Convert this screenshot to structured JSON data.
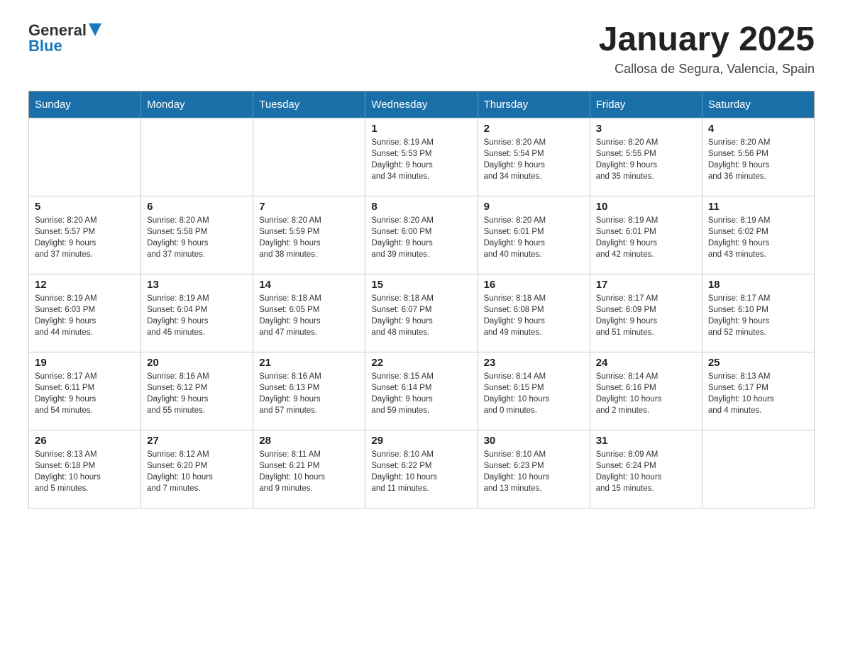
{
  "header": {
    "logo": {
      "text_general": "General",
      "text_blue": "Blue"
    },
    "title": "January 2025",
    "location": "Callosa de Segura, Valencia, Spain"
  },
  "days_of_week": [
    "Sunday",
    "Monday",
    "Tuesday",
    "Wednesday",
    "Thursday",
    "Friday",
    "Saturday"
  ],
  "weeks": [
    {
      "days": [
        {
          "num": "",
          "info": ""
        },
        {
          "num": "",
          "info": ""
        },
        {
          "num": "",
          "info": ""
        },
        {
          "num": "1",
          "info": "Sunrise: 8:19 AM\nSunset: 5:53 PM\nDaylight: 9 hours\nand 34 minutes."
        },
        {
          "num": "2",
          "info": "Sunrise: 8:20 AM\nSunset: 5:54 PM\nDaylight: 9 hours\nand 34 minutes."
        },
        {
          "num": "3",
          "info": "Sunrise: 8:20 AM\nSunset: 5:55 PM\nDaylight: 9 hours\nand 35 minutes."
        },
        {
          "num": "4",
          "info": "Sunrise: 8:20 AM\nSunset: 5:56 PM\nDaylight: 9 hours\nand 36 minutes."
        }
      ]
    },
    {
      "days": [
        {
          "num": "5",
          "info": "Sunrise: 8:20 AM\nSunset: 5:57 PM\nDaylight: 9 hours\nand 37 minutes."
        },
        {
          "num": "6",
          "info": "Sunrise: 8:20 AM\nSunset: 5:58 PM\nDaylight: 9 hours\nand 37 minutes."
        },
        {
          "num": "7",
          "info": "Sunrise: 8:20 AM\nSunset: 5:59 PM\nDaylight: 9 hours\nand 38 minutes."
        },
        {
          "num": "8",
          "info": "Sunrise: 8:20 AM\nSunset: 6:00 PM\nDaylight: 9 hours\nand 39 minutes."
        },
        {
          "num": "9",
          "info": "Sunrise: 8:20 AM\nSunset: 6:01 PM\nDaylight: 9 hours\nand 40 minutes."
        },
        {
          "num": "10",
          "info": "Sunrise: 8:19 AM\nSunset: 6:01 PM\nDaylight: 9 hours\nand 42 minutes."
        },
        {
          "num": "11",
          "info": "Sunrise: 8:19 AM\nSunset: 6:02 PM\nDaylight: 9 hours\nand 43 minutes."
        }
      ]
    },
    {
      "days": [
        {
          "num": "12",
          "info": "Sunrise: 8:19 AM\nSunset: 6:03 PM\nDaylight: 9 hours\nand 44 minutes."
        },
        {
          "num": "13",
          "info": "Sunrise: 8:19 AM\nSunset: 6:04 PM\nDaylight: 9 hours\nand 45 minutes."
        },
        {
          "num": "14",
          "info": "Sunrise: 8:18 AM\nSunset: 6:05 PM\nDaylight: 9 hours\nand 47 minutes."
        },
        {
          "num": "15",
          "info": "Sunrise: 8:18 AM\nSunset: 6:07 PM\nDaylight: 9 hours\nand 48 minutes."
        },
        {
          "num": "16",
          "info": "Sunrise: 8:18 AM\nSunset: 6:08 PM\nDaylight: 9 hours\nand 49 minutes."
        },
        {
          "num": "17",
          "info": "Sunrise: 8:17 AM\nSunset: 6:09 PM\nDaylight: 9 hours\nand 51 minutes."
        },
        {
          "num": "18",
          "info": "Sunrise: 8:17 AM\nSunset: 6:10 PM\nDaylight: 9 hours\nand 52 minutes."
        }
      ]
    },
    {
      "days": [
        {
          "num": "19",
          "info": "Sunrise: 8:17 AM\nSunset: 6:11 PM\nDaylight: 9 hours\nand 54 minutes."
        },
        {
          "num": "20",
          "info": "Sunrise: 8:16 AM\nSunset: 6:12 PM\nDaylight: 9 hours\nand 55 minutes."
        },
        {
          "num": "21",
          "info": "Sunrise: 8:16 AM\nSunset: 6:13 PM\nDaylight: 9 hours\nand 57 minutes."
        },
        {
          "num": "22",
          "info": "Sunrise: 8:15 AM\nSunset: 6:14 PM\nDaylight: 9 hours\nand 59 minutes."
        },
        {
          "num": "23",
          "info": "Sunrise: 8:14 AM\nSunset: 6:15 PM\nDaylight: 10 hours\nand 0 minutes."
        },
        {
          "num": "24",
          "info": "Sunrise: 8:14 AM\nSunset: 6:16 PM\nDaylight: 10 hours\nand 2 minutes."
        },
        {
          "num": "25",
          "info": "Sunrise: 8:13 AM\nSunset: 6:17 PM\nDaylight: 10 hours\nand 4 minutes."
        }
      ]
    },
    {
      "days": [
        {
          "num": "26",
          "info": "Sunrise: 8:13 AM\nSunset: 6:18 PM\nDaylight: 10 hours\nand 5 minutes."
        },
        {
          "num": "27",
          "info": "Sunrise: 8:12 AM\nSunset: 6:20 PM\nDaylight: 10 hours\nand 7 minutes."
        },
        {
          "num": "28",
          "info": "Sunrise: 8:11 AM\nSunset: 6:21 PM\nDaylight: 10 hours\nand 9 minutes."
        },
        {
          "num": "29",
          "info": "Sunrise: 8:10 AM\nSunset: 6:22 PM\nDaylight: 10 hours\nand 11 minutes."
        },
        {
          "num": "30",
          "info": "Sunrise: 8:10 AM\nSunset: 6:23 PM\nDaylight: 10 hours\nand 13 minutes."
        },
        {
          "num": "31",
          "info": "Sunrise: 8:09 AM\nSunset: 6:24 PM\nDaylight: 10 hours\nand 15 minutes."
        },
        {
          "num": "",
          "info": ""
        }
      ]
    }
  ]
}
